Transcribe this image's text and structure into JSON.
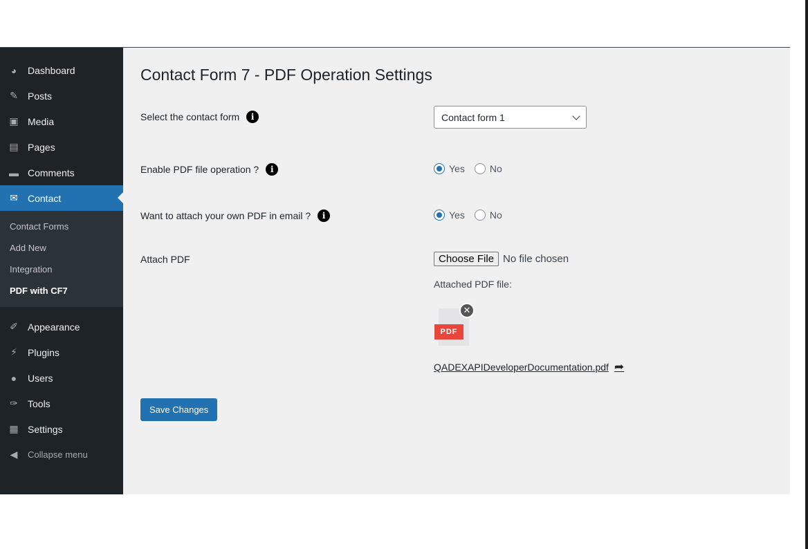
{
  "sidebar": {
    "items_top": [
      {
        "label": "Dashboard",
        "icon": "dashboard-icon",
        "glyph": "◕"
      },
      {
        "label": "Posts",
        "icon": "pin-icon",
        "glyph": "✎"
      },
      {
        "label": "Media",
        "icon": "media-icon",
        "glyph": "▣"
      },
      {
        "label": "Pages",
        "icon": "pages-icon",
        "glyph": "▤"
      },
      {
        "label": "Comments",
        "icon": "comment-icon",
        "glyph": "▬"
      },
      {
        "label": "Contact",
        "icon": "envelope-icon",
        "glyph": "✉"
      }
    ],
    "submenu": [
      "Contact Forms",
      "Add New",
      "Integration",
      "PDF with CF7"
    ],
    "items_bottom": [
      {
        "label": "Appearance",
        "icon": "brush-icon",
        "glyph": "✐"
      },
      {
        "label": "Plugins",
        "icon": "plug-icon",
        "glyph": "⚡"
      },
      {
        "label": "Users",
        "icon": "user-icon",
        "glyph": "●"
      },
      {
        "label": "Tools",
        "icon": "wrench-icon",
        "glyph": "✑"
      },
      {
        "label": "Settings",
        "icon": "settings-icon",
        "glyph": "▦"
      }
    ],
    "collapse": {
      "label": "Collapse menu",
      "icon": "collapse-icon",
      "glyph": "◀"
    }
  },
  "main": {
    "title": "Contact Form 7 - PDF Operation Settings",
    "select_form": {
      "label": "Select the contact form",
      "value": "Contact form 1"
    },
    "enable_pdf": {
      "label": "Enable PDF file operation ?",
      "yes": "Yes",
      "no": "No",
      "selected": "Yes"
    },
    "attach_own": {
      "label": "Want to attach your own PDF in email ?",
      "yes": "Yes",
      "no": "No",
      "selected": "Yes"
    },
    "attach_pdf": {
      "label": "Attach PDF",
      "button": "Choose File",
      "status": "No file chosen",
      "attached_label": "Attached PDF file:",
      "badge": "PDF",
      "filename": "QADEXAPIDeveloperDocumentation.pdf"
    },
    "save_label": "Save Changes"
  },
  "colors": {
    "accent": "#2271b1",
    "sidebar_bg": "#1d2327",
    "submenu_bg": "#2c3338",
    "content_bg": "#f0f0f1",
    "pdf_badge": "#e8463a"
  }
}
